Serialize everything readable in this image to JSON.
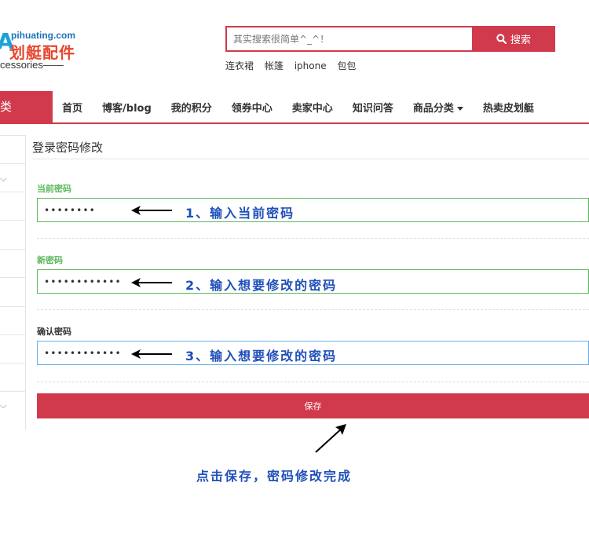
{
  "logo": {
    "domain": "pihuating.com",
    "name_cn": "划艇配件",
    "subtitle": "cessories——"
  },
  "search": {
    "placeholder": "其实搜索很简单^_^！",
    "button_label": "搜索",
    "hot_words": [
      "连衣裙",
      "帐篷",
      "iphone",
      "包包"
    ]
  },
  "nav": {
    "category_label": "类",
    "items": [
      "首页",
      "博客/blog",
      "我的积分",
      "领券中心",
      "卖家中心",
      "知识问答",
      "商品分类",
      "热卖皮划艇"
    ]
  },
  "colors": {
    "brand": "#d13a4c",
    "annotation": "#1f4fb8",
    "label_green": "#5cb85c"
  },
  "form": {
    "title": "登录密码修改",
    "current_label": "当前密码",
    "current_value": "••••••••",
    "new_label": "新密码",
    "new_value": "••••••••••••",
    "confirm_label": "确认密码",
    "confirm_value": "••••••••••••",
    "save_label": "保存"
  },
  "annotations": {
    "step1": "1、输入当前密码",
    "step2": "2、输入想要修改的密码",
    "step3": "3、输入想要修改的密码",
    "final": "点击保存，密码修改完成"
  }
}
